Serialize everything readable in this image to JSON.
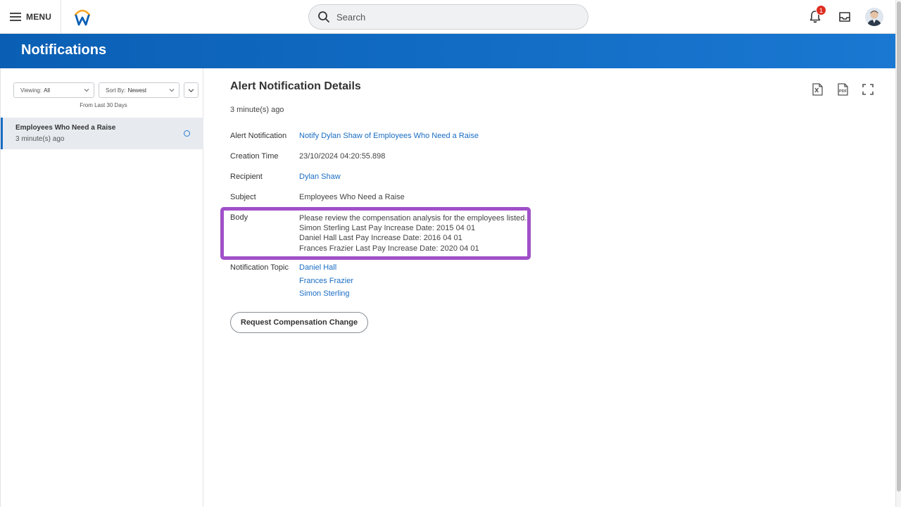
{
  "topbar": {
    "menu_label": "MENU",
    "search_placeholder": "Search",
    "notification_count": "1",
    "icons": [
      "menu-icon",
      "workday-logo",
      "search-icon",
      "bell-icon",
      "inbox-icon",
      "avatar"
    ]
  },
  "page": {
    "title": "Notifications"
  },
  "filters": {
    "viewing_label": "Viewing:",
    "viewing_value": "All",
    "sort_label": "Sort By:",
    "sort_value": "Newest",
    "range_text": "From Last 30 Days"
  },
  "list": [
    {
      "title": "Employees Who Need a Raise",
      "time": "3 minute(s) ago"
    }
  ],
  "details": {
    "title": "Alert Notification Details",
    "ago": "3 minute(s) ago",
    "alert_notification_label": "Alert Notification",
    "alert_notification_value": "Notify Dylan Shaw of Employees Who Need a Raise",
    "creation_time_label": "Creation Time",
    "creation_time_value": "23/10/2024 04:20:55.898",
    "recipient_label": "Recipient",
    "recipient_value": "Dylan Shaw",
    "subject_label": "Subject",
    "subject_value": "Employees Who Need a Raise",
    "body_label": "Body",
    "body_lines": [
      "Please review the compensation analysis for the employees listed.",
      "Simon Sterling Last Pay Increase Date: 2015 04 01",
      "Daniel Hall Last Pay Increase Date: 2016 04 01",
      "Frances Frazier Last Pay Increase Date: 2020 04 01"
    ],
    "topic_label": "Notification Topic",
    "topics": [
      "Daniel Hall",
      "Frances Frazier",
      "Simon Sterling"
    ],
    "button_label": "Request Compensation Change"
  },
  "colors": {
    "brand_blue": "#0a5fb4",
    "link": "#1a6dc4",
    "highlight": "#a050c8",
    "badge": "#de2e21"
  }
}
